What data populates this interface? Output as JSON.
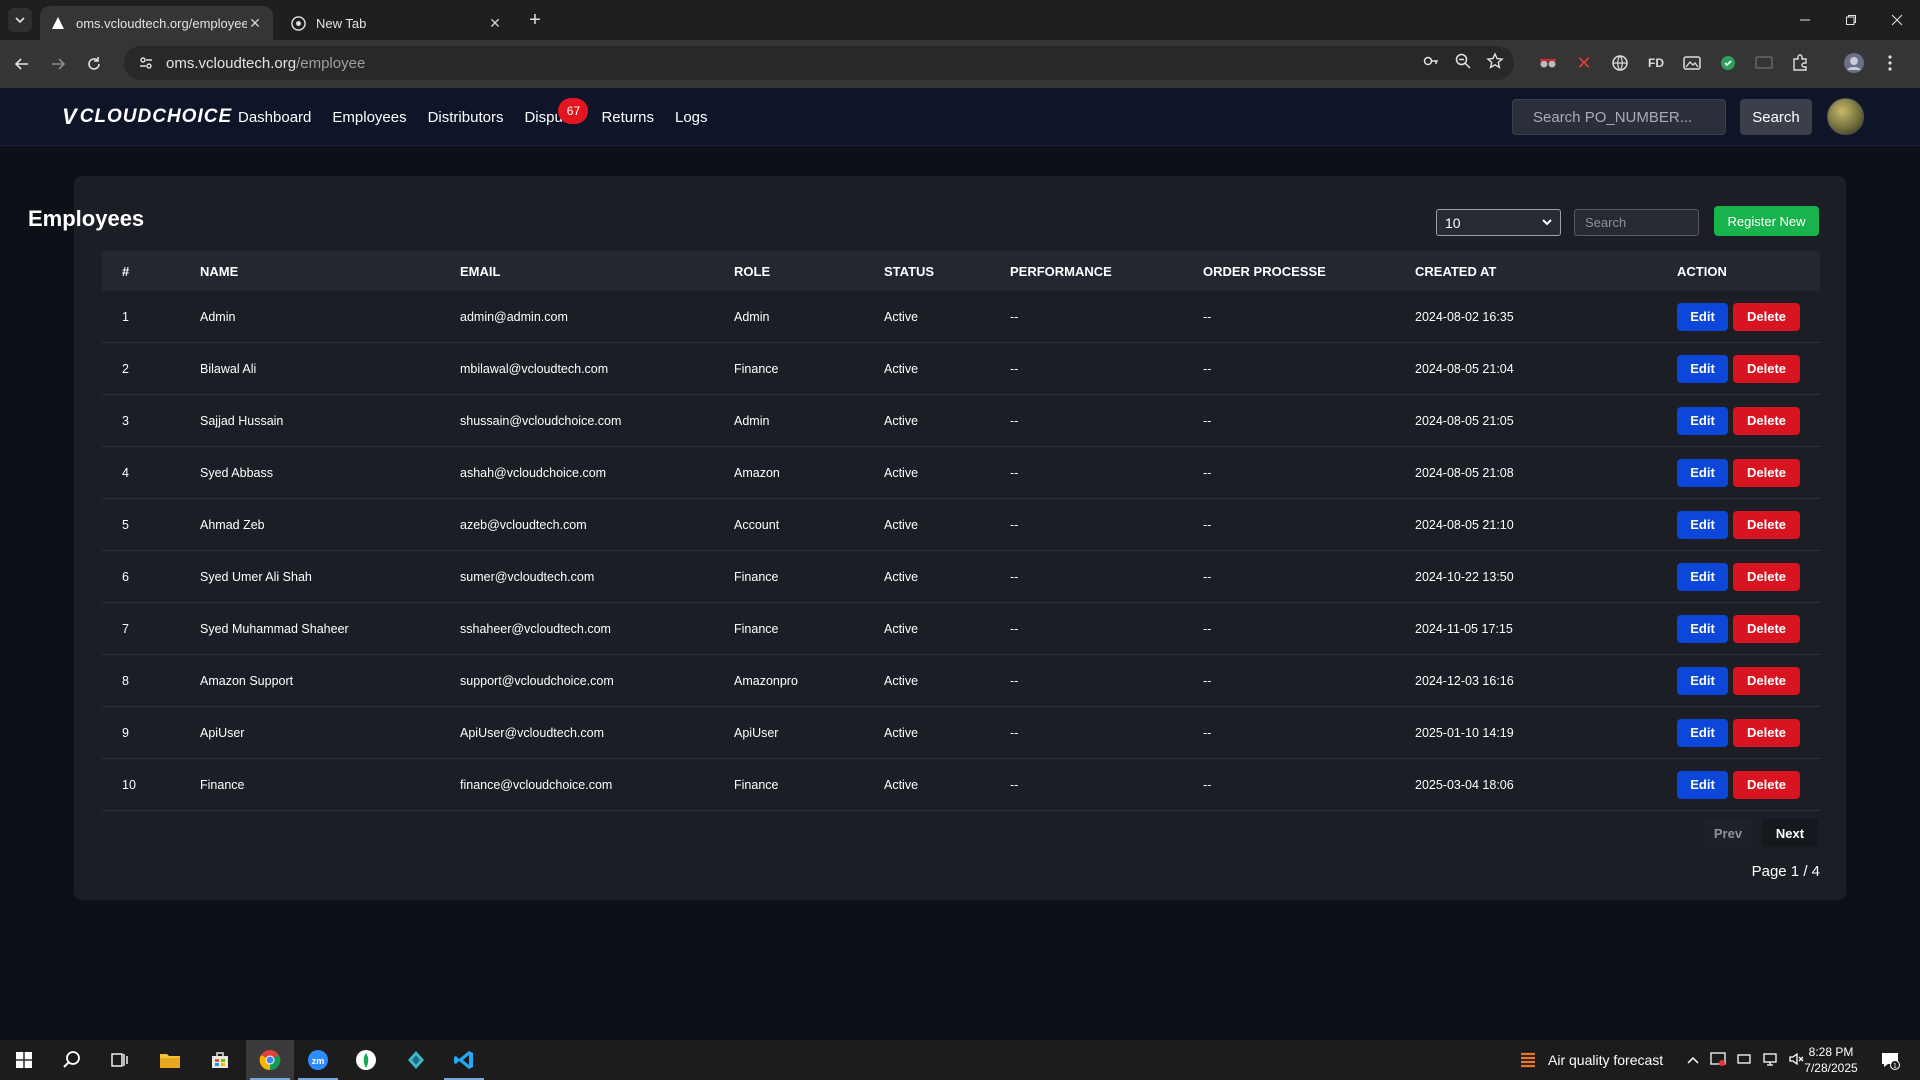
{
  "browser": {
    "tabs": [
      {
        "title": "oms.vcloudtech.org/employee",
        "active": true
      },
      {
        "title": "New Tab",
        "active": false
      }
    ],
    "url_host": "oms.vcloudtech.org",
    "url_path": "/employee",
    "extensions": [
      "FD"
    ]
  },
  "nav": {
    "logo_text": "CLOUDCHOICE",
    "logo_mark": "V",
    "links": [
      "Dashboard",
      "Employees",
      "Distributors",
      "Dispu",
      "Returns",
      "Logs"
    ],
    "dispute_badge": "67",
    "po_search_placeholder": "Search PO_NUMBER...",
    "search_button": "Search"
  },
  "page": {
    "title": "Employees",
    "page_size": "10",
    "search_placeholder": "Search",
    "register_button": "Register New",
    "columns": [
      "#",
      "NAME",
      "EMAIL",
      "ROLE",
      "STATUS",
      "PERFORMANCE",
      "ORDER PROCESSE",
      "CREATED AT",
      "ACTION"
    ],
    "edit_label": "Edit",
    "delete_label": "Delete",
    "rows": [
      {
        "num": "1",
        "name": "Admin",
        "email": "admin@admin.com",
        "role": "Admin",
        "status": "Active",
        "performance": "--",
        "orders": "--",
        "created": "2024-08-02 16:35"
      },
      {
        "num": "2",
        "name": "Bilawal Ali",
        "email": "mbilawal@vcloudtech.com",
        "role": "Finance",
        "status": "Active",
        "performance": "--",
        "orders": "--",
        "created": "2024-08-05 21:04"
      },
      {
        "num": "3",
        "name": "Sajjad Hussain",
        "email": "shussain@vcloudchoice.com",
        "role": "Admin",
        "status": "Active",
        "performance": "--",
        "orders": "--",
        "created": "2024-08-05 21:05"
      },
      {
        "num": "4",
        "name": "Syed Abbass",
        "email": "ashah@vcloudchoice.com",
        "role": "Amazon",
        "status": "Active",
        "performance": "--",
        "orders": "--",
        "created": "2024-08-05 21:08"
      },
      {
        "num": "5",
        "name": "Ahmad Zeb",
        "email": "azeb@vcloudtech.com",
        "role": "Account",
        "status": "Active",
        "performance": "--",
        "orders": "--",
        "created": "2024-08-05 21:10"
      },
      {
        "num": "6",
        "name": "Syed Umer Ali Shah",
        "email": "sumer@vcloudtech.com",
        "role": "Finance",
        "status": "Active",
        "performance": "--",
        "orders": "--",
        "created": "2024-10-22 13:50"
      },
      {
        "num": "7",
        "name": "Syed Muhammad Shaheer",
        "email": "sshaheer@vcloudtech.com",
        "role": "Finance",
        "status": "Active",
        "performance": "--",
        "orders": "--",
        "created": "2024-11-05 17:15"
      },
      {
        "num": "8",
        "name": "Amazon Support",
        "email": "support@vcloudchoice.com",
        "role": "Amazonpro",
        "status": "Active",
        "performance": "--",
        "orders": "--",
        "created": "2024-12-03 16:16"
      },
      {
        "num": "9",
        "name": "ApiUser",
        "email": "ApiUser@vcloudtech.com",
        "role": "ApiUser",
        "status": "Active",
        "performance": "--",
        "orders": "--",
        "created": "2025-01-10 14:19"
      },
      {
        "num": "10",
        "name": "Finance",
        "email": "finance@vcloudchoice.com",
        "role": "Finance",
        "status": "Active",
        "performance": "--",
        "orders": "--",
        "created": "2025-03-04 18:06"
      }
    ],
    "prev_label": "Prev",
    "next_label": "Next",
    "page_info": "Page 1 / 4"
  },
  "taskbar": {
    "weather_text": "Air quality forecast",
    "time": "8:28 PM",
    "date": "7/28/2025"
  },
  "colors": {
    "edit": "#0d47d9",
    "delete": "#d7141f",
    "register": "#18b34c",
    "badge": "#e3151f"
  }
}
